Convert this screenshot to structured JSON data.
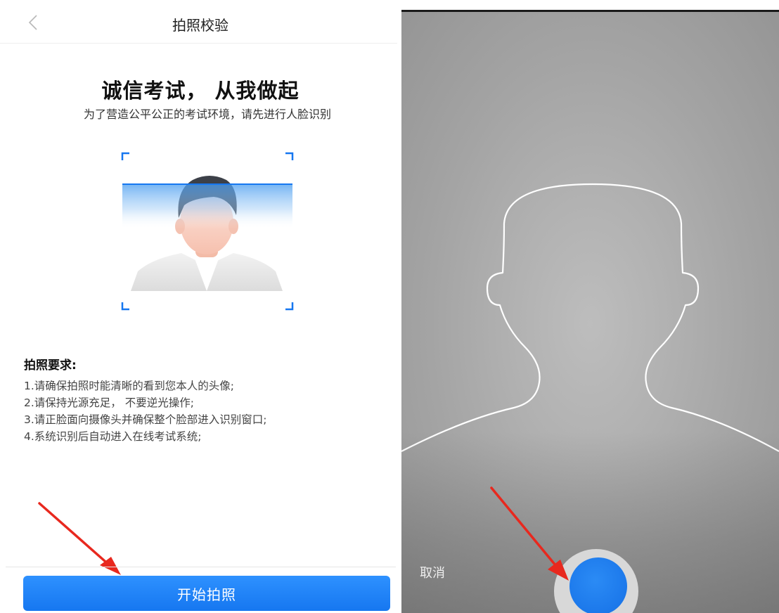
{
  "left_screen": {
    "nav": {
      "title": "拍照校验",
      "back_icon": "chevron-left-icon"
    },
    "slogan": "诚信考试， 从我做起",
    "subtitle": "为了营造公平公正的考试环境，请先进行人脸识别",
    "requirements": {
      "title": "拍照要求:",
      "items": [
        "1.请确保拍照时能清晰的看到您本人的头像;",
        "2.请保持光源充足， 不要逆光操作;",
        "3.请正脸面向摄像头并确保整个脸部进入识别窗口;",
        "4.系统识别后自动进入在线考试系统;"
      ]
    },
    "start_button": {
      "label": "开始拍照"
    }
  },
  "right_screen": {
    "cancel_label": "取消",
    "shutter_icon": "camera-shutter-icon"
  },
  "colors": {
    "accent_blue": "#1677f0",
    "annotation_red": "#e8281e",
    "camera_bg": "#a8a8a8"
  }
}
